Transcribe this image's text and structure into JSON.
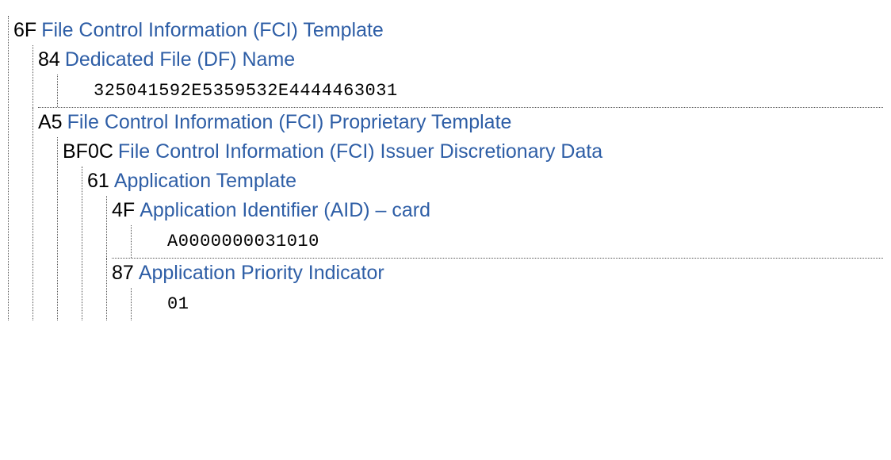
{
  "tree": {
    "n6F": {
      "tag": "6F",
      "label": "File Control Information (FCI) Template"
    },
    "n84": {
      "tag": "84",
      "label": "Dedicated File (DF) Name",
      "value": "325041592E5359532E4444463031"
    },
    "nA5": {
      "tag": "A5",
      "label": "File Control Information (FCI) Proprietary Template"
    },
    "nBF0C": {
      "tag": "BF0C",
      "label": "File Control Information (FCI) Issuer Discretionary Data"
    },
    "n61": {
      "tag": "61",
      "label": "Application Template"
    },
    "n4F": {
      "tag": "4F",
      "label": "Application Identifier (AID) – card",
      "value": "A0000000031010"
    },
    "n87": {
      "tag": "87",
      "label": "Application Priority Indicator",
      "value": "01"
    }
  }
}
